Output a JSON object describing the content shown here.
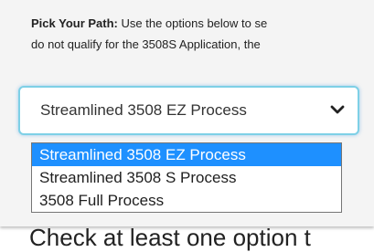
{
  "intro": {
    "label": "Pick Your Path:",
    "line1_rest": " Use the options below to se",
    "line2": "do not qualify for the 3508S Application, the"
  },
  "select": {
    "value": "Streamlined 3508 EZ Process",
    "options": [
      {
        "label": "Streamlined 3508 EZ Process",
        "selected": true
      },
      {
        "label": "Streamlined 3508 S Process",
        "selected": false
      },
      {
        "label": "3508 Full Process",
        "selected": false
      }
    ]
  },
  "below_text": "Check at least one option t",
  "icons": {
    "dropdown": "chevron-down-icon"
  },
  "colors": {
    "focus_border": "#7ed0e6",
    "selected_option": "#1e90ff"
  }
}
